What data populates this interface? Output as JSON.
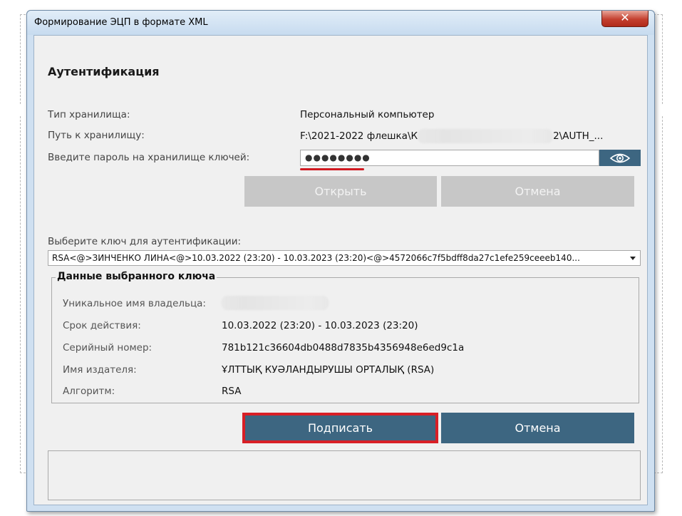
{
  "window": {
    "title": "Формирование ЭЦП в формате XML",
    "close_glyph": "✕"
  },
  "auth": {
    "title": "Аутентификация",
    "storage_type_label": "Тип хранилища:",
    "storage_type_value": "Персональный компьютер",
    "storage_path_label": "Путь к хранилищу:",
    "storage_path_prefix": "F:\\2021-2022 флешка\\К",
    "storage_path_suffix": "2\\AUTH_...",
    "password_label": "Введите пароль на хранилище ключей:",
    "password_value": "●●●●●●●●",
    "show_password_icon": "eye-icon",
    "open_button": "Открыть",
    "cancel_button": "Отмена"
  },
  "key_select": {
    "label": "Выберите ключ для аутентификации:",
    "selected": "RSA<@>ЗИНЧЕНКО ЛИНА<@>10.03.2022 (23:20) - 10.03.2023 (23:20)<@>4572066c7f5bdff8da27c1efe259ceeeb140..."
  },
  "key_details": {
    "title": "Данные выбранного ключа",
    "owner_label": "Уникальное имя владельца:",
    "validity_label": "Срок действия:",
    "validity_value": "10.03.2022 (23:20) - 10.03.2023 (23:20)",
    "serial_label": "Серийный номер:",
    "serial_value": "781b121c36604db0488d7835b4356948e6ed9c1a",
    "issuer_label": "Имя издателя:",
    "issuer_value": "ҰЛТТЫҚ КУӘЛАНДЫРУШЫ ОРТАЛЫҚ (RSA)",
    "algorithm_label": "Алгоритм:",
    "algorithm_value": "RSA"
  },
  "actions": {
    "sign_button": "Подписать",
    "cancel_button": "Отмена"
  },
  "colors": {
    "primary": "#3d6681",
    "disabled": "#c7c7c7",
    "highlight": "#d81f26",
    "title_bar": "#cfe0f1"
  }
}
